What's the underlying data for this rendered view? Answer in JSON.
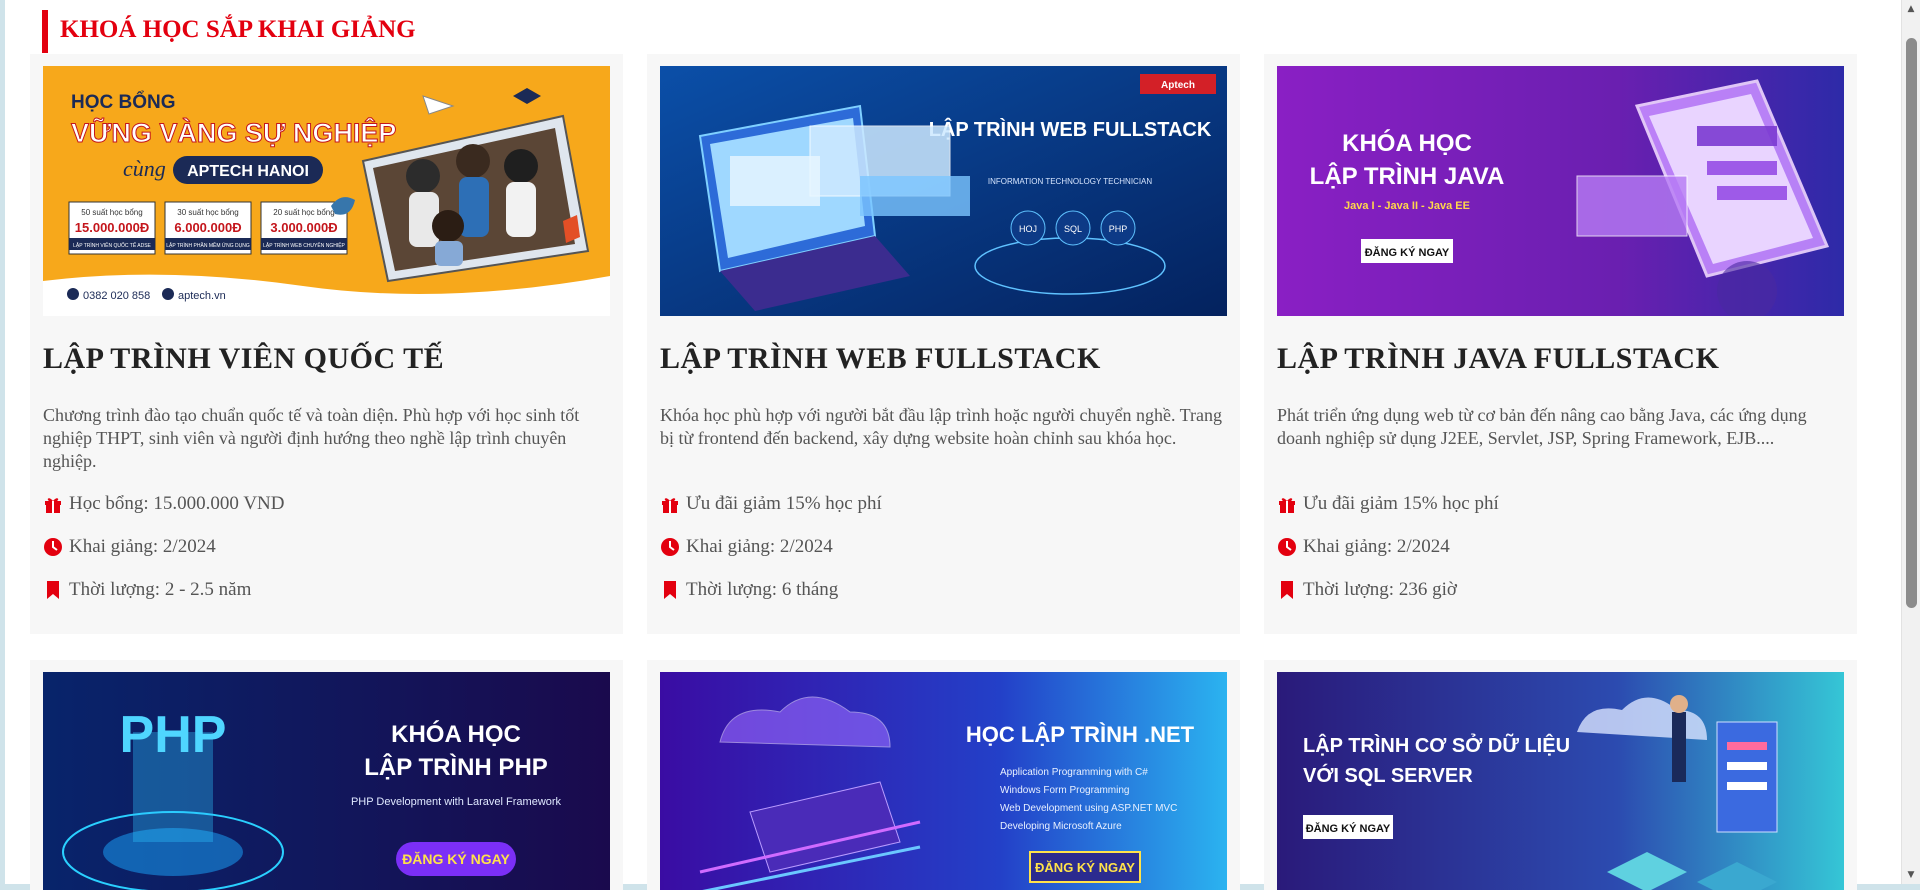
{
  "section": {
    "title": "KHOÁ HỌC SẮP KHAI GIẢNG"
  },
  "colors": {
    "accent": "#e3000f",
    "card_bg": "#f7f7f7"
  },
  "courses": [
    {
      "title": "LẬP TRÌNH VIÊN QUỐC TẾ",
      "description": "Chương trình đào tạo chuẩn quốc tế và toàn diện. Phù hợp với học sinh tốt nghiệp THPT, sinh viên và người định hướng theo nghề lập trình chuyên nghiệp.",
      "offer": "Học bổng: 15.000.000 VND",
      "start": "Khai giảng: 2/2024",
      "duration": "Thời lượng: 2 - 2.5 năm",
      "banner": {
        "line1": "HỌC BỔNG",
        "line2": "VỮNG VÀNG SỰ NGHIỆP",
        "line3": "cùng",
        "brand": "APTECH HANOI",
        "s1_label": "50 suất học bổng",
        "s1_value": "15.000.000Đ",
        "s1_sub": "LẬP TRÌNH VIÊN QUỐC TẾ ADSE",
        "s2_label": "30 suất học bổng",
        "s2_value": "6.000.000Đ",
        "s2_sub": "LẬP TRÌNH PHẦN MỀM ỨNG DỤNG",
        "s3_label": "20 suất học bổng",
        "s3_value": "3.000.000Đ",
        "s3_sub": "LẬP TRÌNH WEB CHUYÊN NGHIỆP",
        "phone": "0382 020 858",
        "site": "aptech.vn"
      }
    },
    {
      "title": "LẬP TRÌNH WEB FULLSTACK",
      "description": "Khóa học phù hợp với người bắt đầu lập trình hoặc người chuyển nghề. Trang bị từ frontend đến backend, xây dựng website hoàn chỉnh sau khóa học.",
      "offer": "Ưu đãi giảm 15% học phí",
      "start": "Khai giảng: 2/2024",
      "duration": "Thời lượng: 6 tháng",
      "banner": {
        "heading": "LẬP TRÌNH WEB FULLSTACK",
        "sub": "INFORMATION TECHNOLOGY TECHNICIAN",
        "tags": [
          "HOJ",
          "SQL",
          "PHP"
        ],
        "logo": "Aptech"
      }
    },
    {
      "title": "LẬP TRÌNH JAVA FULLSTACK",
      "description": "Phát triển ứng dụng web từ cơ bản đến nâng cao bằng Java, các ứng dụng doanh nghiệp sử dụng J2EE, Servlet, JSP, Spring Framework, EJB....",
      "offer": "Ưu đãi giảm 15% học phí",
      "start": "Khai giảng: 2/2024",
      "duration": "Thời lượng: 236 giờ",
      "banner": {
        "heading1": "KHÓA HỌC",
        "heading2": "LẬP TRÌNH JAVA",
        "sub": "Java I - Java II - Java EE",
        "cta": "ĐĂNG KÝ NGAY"
      }
    },
    {
      "banner": {
        "logo": "PHP",
        "heading1": "KHÓA HỌC",
        "heading2": "LẬP TRÌNH PHP",
        "sub": "PHP Development with Laravel Framework",
        "cta": "ĐĂNG KÝ NGAY"
      }
    },
    {
      "banner": {
        "heading": "HỌC LẬP TRÌNH .NET",
        "bullets": [
          "Application Programming with C#",
          "Windows Form Programming",
          "Web Development using ASP.NET MVC",
          "Developing Microsoft Azure"
        ],
        "cta": "ĐĂNG KÝ NGAY"
      }
    },
    {
      "banner": {
        "heading1": "LẬP TRÌNH CƠ SỞ DỮ LIỆU",
        "heading2": "VỚI SQL SERVER",
        "cta": "ĐĂNG KÝ NGAY"
      }
    }
  ]
}
